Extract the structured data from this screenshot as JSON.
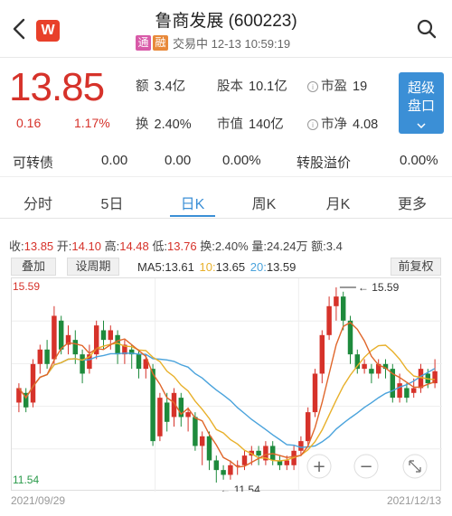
{
  "header": {
    "title": "鲁商发展 (600223)",
    "tag_tong": "通",
    "tag_rong": "融",
    "status": "交易中 12-13 10:59:19",
    "logo": "W"
  },
  "quote": {
    "price": "13.85",
    "change": "0.16",
    "change_pct": "1.17%",
    "amount_label": "额",
    "amount": "3.4亿",
    "turnover_label": "换",
    "turnover": "2.40%",
    "shares_label": "股本",
    "shares": "10.1亿",
    "mcap_label": "市值",
    "mcap": "140亿",
    "pe_label": "市盈",
    "pe": "19",
    "pb_label": "市净",
    "pb": "4.08",
    "super_btn_1": "超级",
    "super_btn_2": "盘口"
  },
  "convertible": {
    "label": "可转债",
    "v1": "0.00",
    "v2": "0.00",
    "v3": "0.00%",
    "premium_label": "转股溢价",
    "premium": "0.00%"
  },
  "tabs": [
    "分时",
    "5日",
    "日K",
    "周K",
    "月K",
    "更多"
  ],
  "active_tab": "日K",
  "stats": {
    "close_label": "收:",
    "close": "13.85",
    "open_label": "开:",
    "open": "14.10",
    "high_label": "高:",
    "high": "14.48",
    "low_label": "低:",
    "low": "13.76",
    "turn_label": "换:",
    "turn": "2.40%",
    "vol_label": "量:",
    "vol": "24.24万",
    "amt_label": "额:",
    "amt": "3.4"
  },
  "toolbar": {
    "overlay": "叠加",
    "period": "设周期",
    "ma5_label": "MA5:",
    "ma5": "13.61",
    "ma10_label": "10:",
    "ma10": "13.65",
    "ma20_label": "20:",
    "ma20": "13.59",
    "adjust": "前复权"
  },
  "colors": {
    "up": "#d6322a",
    "down": "#1e8a3c",
    "ma5": "#e0662a",
    "ma10": "#e8b02a",
    "ma20": "#4aa3dc",
    "accent": "#3b8fd6"
  },
  "chart_data": {
    "type": "candlestick",
    "y_max_label": "15.59",
    "y_min_label": "11.54",
    "high_marker": "15.59",
    "low_marker": "11.54",
    "x_start": "2021/09/29",
    "x_end": "2021/12/13",
    "ylim": [
      11.54,
      15.59
    ],
    "candles": [
      [
        13.2,
        13.5,
        13.0,
        13.6
      ],
      [
        13.4,
        13.1,
        13.0,
        13.5
      ],
      [
        13.2,
        14.0,
        13.1,
        14.1
      ],
      [
        14.0,
        14.3,
        13.8,
        14.4
      ],
      [
        14.3,
        14.0,
        13.9,
        14.5
      ],
      [
        14.1,
        15.0,
        14.0,
        15.2
      ],
      [
        14.9,
        14.3,
        14.2,
        15.0
      ],
      [
        14.4,
        14.6,
        14.2,
        14.8
      ],
      [
        14.5,
        14.2,
        14.0,
        14.7
      ],
      [
        14.2,
        13.8,
        13.6,
        14.3
      ],
      [
        13.9,
        14.2,
        13.8,
        14.4
      ],
      [
        14.2,
        14.8,
        14.1,
        14.9
      ],
      [
        14.7,
        14.5,
        14.3,
        14.9
      ],
      [
        14.5,
        14.7,
        14.3,
        14.8
      ],
      [
        14.6,
        14.2,
        14.0,
        14.7
      ],
      [
        14.2,
        14.4,
        14.0,
        14.5
      ],
      [
        14.3,
        14.2,
        13.9,
        14.4
      ],
      [
        14.2,
        13.9,
        13.7,
        14.3
      ],
      [
        13.9,
        14.1,
        13.7,
        14.2
      ],
      [
        13.9,
        12.4,
        12.3,
        14.0
      ],
      [
        12.5,
        13.3,
        12.4,
        13.4
      ],
      [
        13.2,
        12.8,
        12.6,
        13.4
      ],
      [
        12.9,
        13.4,
        12.7,
        13.5
      ],
      [
        13.3,
        12.9,
        12.7,
        13.4
      ],
      [
        12.9,
        13.0,
        12.6,
        13.1
      ],
      [
        12.9,
        12.3,
        12.2,
        13.0
      ],
      [
        12.3,
        12.5,
        11.9,
        12.6
      ],
      [
        12.5,
        12.0,
        11.8,
        12.6
      ],
      [
        12.0,
        11.8,
        11.54,
        12.1
      ],
      [
        11.8,
        11.7,
        11.6,
        11.9
      ],
      [
        11.7,
        11.9,
        11.6,
        12.0
      ],
      [
        11.9,
        11.9,
        11.7,
        12.0
      ],
      [
        11.9,
        12.1,
        11.8,
        12.2
      ],
      [
        12.1,
        12.2,
        11.9,
        12.3
      ],
      [
        12.2,
        12.1,
        11.9,
        12.3
      ],
      [
        12.0,
        12.3,
        11.9,
        12.4
      ],
      [
        12.3,
        12.0,
        11.9,
        12.4
      ],
      [
        12.0,
        11.9,
        11.8,
        12.1
      ],
      [
        11.9,
        12.0,
        11.8,
        12.1
      ],
      [
        11.9,
        12.2,
        11.8,
        12.3
      ],
      [
        12.2,
        12.4,
        12.1,
        12.5
      ],
      [
        12.4,
        13.0,
        12.3,
        13.1
      ],
      [
        13.0,
        13.8,
        12.9,
        13.9
      ],
      [
        13.8,
        14.6,
        13.6,
        14.7
      ],
      [
        14.6,
        15.2,
        14.5,
        15.4
      ],
      [
        15.2,
        15.4,
        14.9,
        15.59
      ],
      [
        15.4,
        14.9,
        14.7,
        15.5
      ],
      [
        14.9,
        14.2,
        14.0,
        15.0
      ],
      [
        14.2,
        13.9,
        13.8,
        14.3
      ],
      [
        13.9,
        14.0,
        13.8,
        14.1
      ],
      [
        13.9,
        13.8,
        13.6,
        14.0
      ],
      [
        13.8,
        14.0,
        13.7,
        14.1
      ],
      [
        14.0,
        13.9,
        13.7,
        14.1
      ],
      [
        13.9,
        13.3,
        13.2,
        14.0
      ],
      [
        13.3,
        13.6,
        13.2,
        13.8
      ],
      [
        13.5,
        13.3,
        13.2,
        13.6
      ],
      [
        13.4,
        13.5,
        13.3,
        13.7
      ],
      [
        13.5,
        13.9,
        13.4,
        14.0
      ],
      [
        13.8,
        13.6,
        13.5,
        13.9
      ],
      [
        13.6,
        13.85,
        13.5,
        14.1
      ]
    ]
  }
}
